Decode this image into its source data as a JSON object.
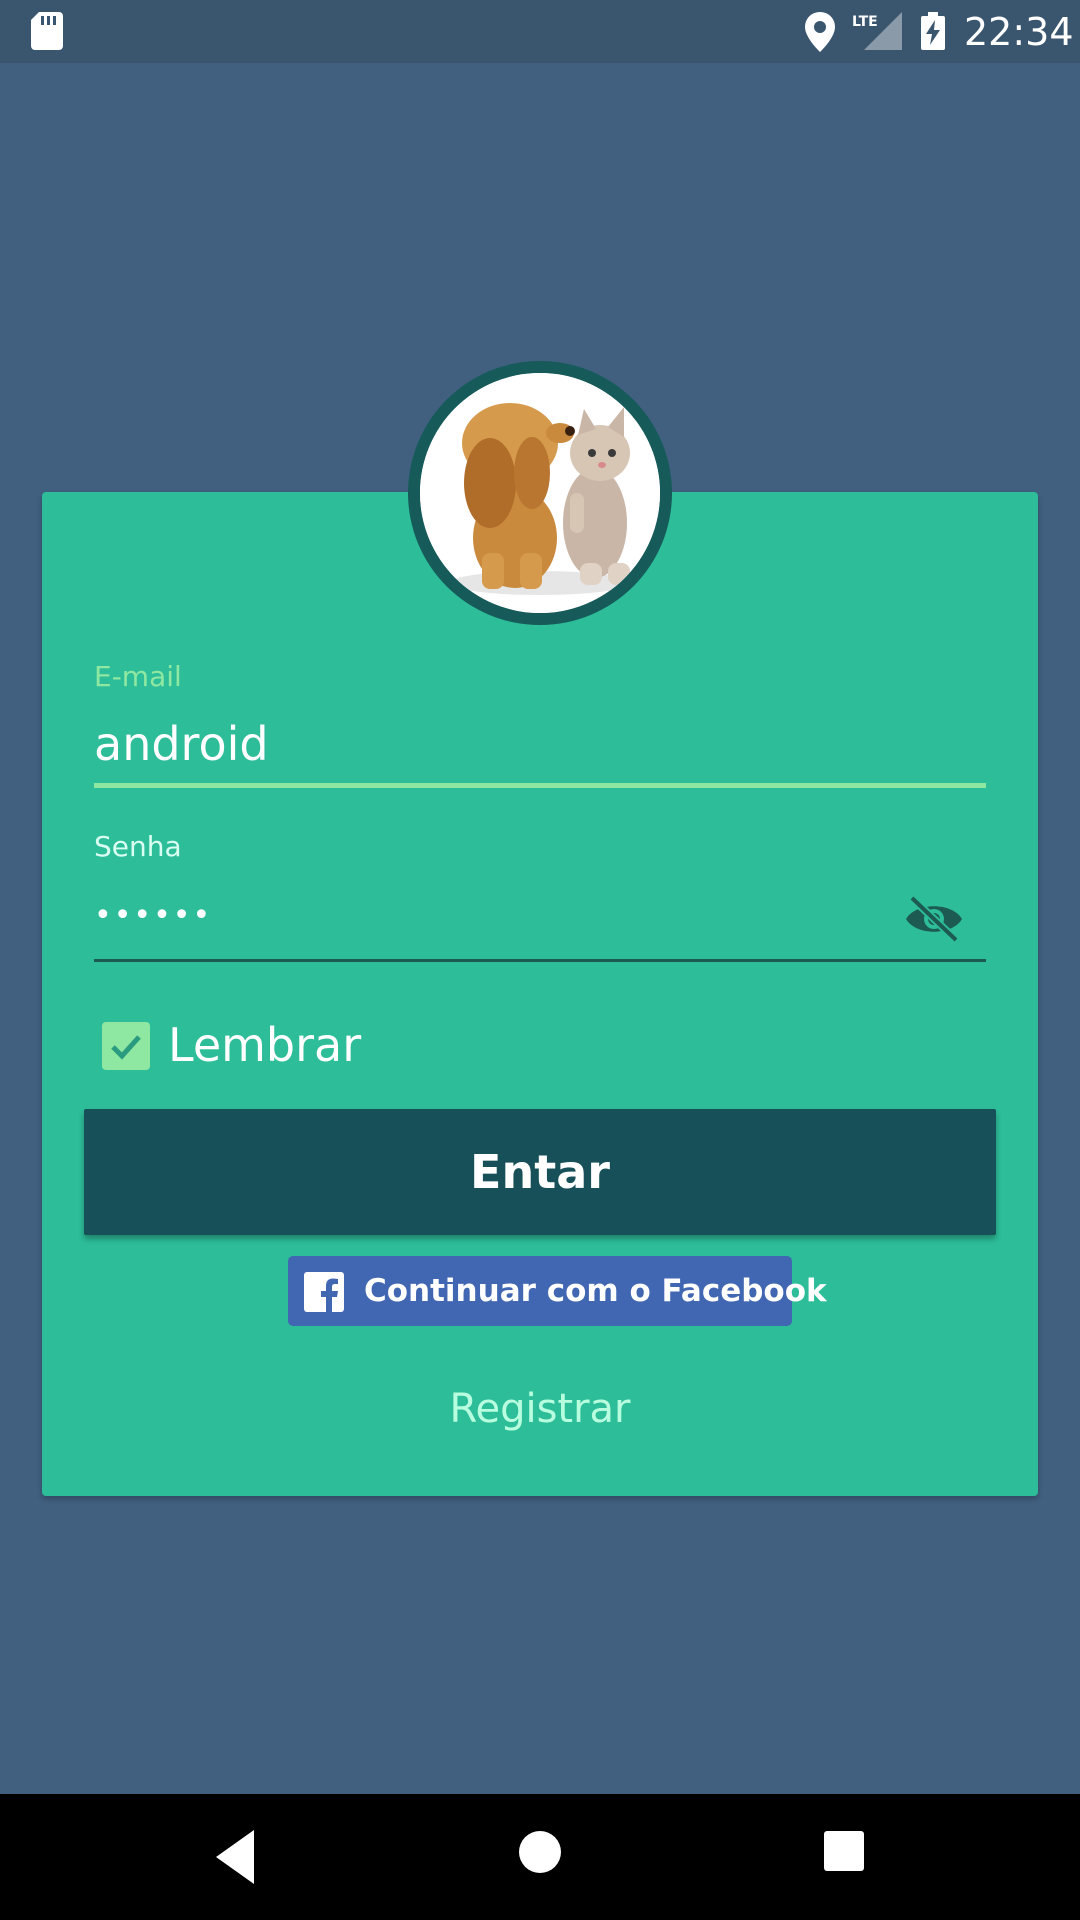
{
  "status_bar": {
    "time": "22:34",
    "network": "LTE",
    "icons": [
      "sd-card-icon",
      "location-icon",
      "lte-signal-icon",
      "battery-charging-icon"
    ]
  },
  "login": {
    "email_label": "E-mail",
    "email_value": "android",
    "password_label": "Senha",
    "password_value": "••••••",
    "remember_label": "Lembrar",
    "remember_checked": true,
    "submit_label": "Entar",
    "facebook_label": "Continuar com o Facebook",
    "register_label": "Registrar"
  },
  "colors": {
    "background": "#416080",
    "card": "#2dbd99",
    "accent": "#8fe8a1",
    "button": "#175058",
    "facebook": "#4267b2"
  },
  "nav_bar": {
    "icons": [
      "back-icon",
      "home-icon",
      "recent-apps-icon"
    ]
  }
}
